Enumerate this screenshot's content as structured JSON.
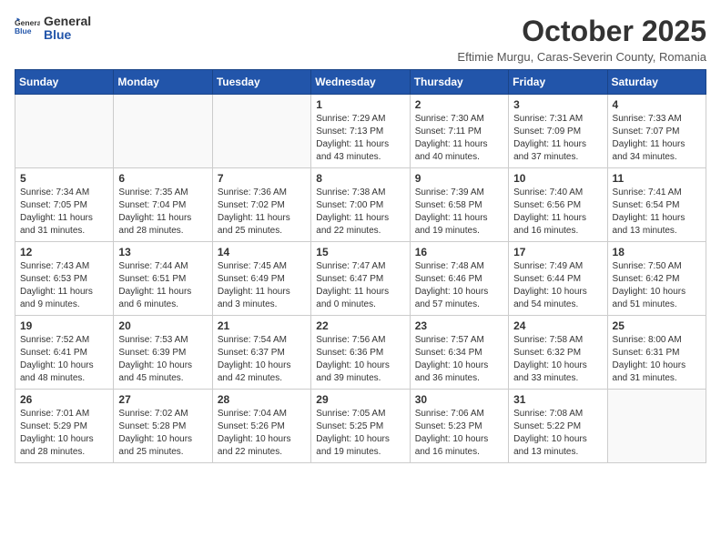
{
  "header": {
    "logo_general": "General",
    "logo_blue": "Blue",
    "title": "October 2025",
    "subtitle": "Eftimie Murgu, Caras-Severin County, Romania"
  },
  "columns": [
    "Sunday",
    "Monday",
    "Tuesday",
    "Wednesday",
    "Thursday",
    "Friday",
    "Saturday"
  ],
  "weeks": [
    {
      "alt": false,
      "days": [
        {
          "num": "",
          "info": ""
        },
        {
          "num": "",
          "info": ""
        },
        {
          "num": "",
          "info": ""
        },
        {
          "num": "1",
          "info": "Sunrise: 7:29 AM\nSunset: 7:13 PM\nDaylight: 11 hours\nand 43 minutes."
        },
        {
          "num": "2",
          "info": "Sunrise: 7:30 AM\nSunset: 7:11 PM\nDaylight: 11 hours\nand 40 minutes."
        },
        {
          "num": "3",
          "info": "Sunrise: 7:31 AM\nSunset: 7:09 PM\nDaylight: 11 hours\nand 37 minutes."
        },
        {
          "num": "4",
          "info": "Sunrise: 7:33 AM\nSunset: 7:07 PM\nDaylight: 11 hours\nand 34 minutes."
        }
      ]
    },
    {
      "alt": true,
      "days": [
        {
          "num": "5",
          "info": "Sunrise: 7:34 AM\nSunset: 7:05 PM\nDaylight: 11 hours\nand 31 minutes."
        },
        {
          "num": "6",
          "info": "Sunrise: 7:35 AM\nSunset: 7:04 PM\nDaylight: 11 hours\nand 28 minutes."
        },
        {
          "num": "7",
          "info": "Sunrise: 7:36 AM\nSunset: 7:02 PM\nDaylight: 11 hours\nand 25 minutes."
        },
        {
          "num": "8",
          "info": "Sunrise: 7:38 AM\nSunset: 7:00 PM\nDaylight: 11 hours\nand 22 minutes."
        },
        {
          "num": "9",
          "info": "Sunrise: 7:39 AM\nSunset: 6:58 PM\nDaylight: 11 hours\nand 19 minutes."
        },
        {
          "num": "10",
          "info": "Sunrise: 7:40 AM\nSunset: 6:56 PM\nDaylight: 11 hours\nand 16 minutes."
        },
        {
          "num": "11",
          "info": "Sunrise: 7:41 AM\nSunset: 6:54 PM\nDaylight: 11 hours\nand 13 minutes."
        }
      ]
    },
    {
      "alt": false,
      "days": [
        {
          "num": "12",
          "info": "Sunrise: 7:43 AM\nSunset: 6:53 PM\nDaylight: 11 hours\nand 9 minutes."
        },
        {
          "num": "13",
          "info": "Sunrise: 7:44 AM\nSunset: 6:51 PM\nDaylight: 11 hours\nand 6 minutes."
        },
        {
          "num": "14",
          "info": "Sunrise: 7:45 AM\nSunset: 6:49 PM\nDaylight: 11 hours\nand 3 minutes."
        },
        {
          "num": "15",
          "info": "Sunrise: 7:47 AM\nSunset: 6:47 PM\nDaylight: 11 hours\nand 0 minutes."
        },
        {
          "num": "16",
          "info": "Sunrise: 7:48 AM\nSunset: 6:46 PM\nDaylight: 10 hours\nand 57 minutes."
        },
        {
          "num": "17",
          "info": "Sunrise: 7:49 AM\nSunset: 6:44 PM\nDaylight: 10 hours\nand 54 minutes."
        },
        {
          "num": "18",
          "info": "Sunrise: 7:50 AM\nSunset: 6:42 PM\nDaylight: 10 hours\nand 51 minutes."
        }
      ]
    },
    {
      "alt": true,
      "days": [
        {
          "num": "19",
          "info": "Sunrise: 7:52 AM\nSunset: 6:41 PM\nDaylight: 10 hours\nand 48 minutes."
        },
        {
          "num": "20",
          "info": "Sunrise: 7:53 AM\nSunset: 6:39 PM\nDaylight: 10 hours\nand 45 minutes."
        },
        {
          "num": "21",
          "info": "Sunrise: 7:54 AM\nSunset: 6:37 PM\nDaylight: 10 hours\nand 42 minutes."
        },
        {
          "num": "22",
          "info": "Sunrise: 7:56 AM\nSunset: 6:36 PM\nDaylight: 10 hours\nand 39 minutes."
        },
        {
          "num": "23",
          "info": "Sunrise: 7:57 AM\nSunset: 6:34 PM\nDaylight: 10 hours\nand 36 minutes."
        },
        {
          "num": "24",
          "info": "Sunrise: 7:58 AM\nSunset: 6:32 PM\nDaylight: 10 hours\nand 33 minutes."
        },
        {
          "num": "25",
          "info": "Sunrise: 8:00 AM\nSunset: 6:31 PM\nDaylight: 10 hours\nand 31 minutes."
        }
      ]
    },
    {
      "alt": false,
      "days": [
        {
          "num": "26",
          "info": "Sunrise: 7:01 AM\nSunset: 5:29 PM\nDaylight: 10 hours\nand 28 minutes."
        },
        {
          "num": "27",
          "info": "Sunrise: 7:02 AM\nSunset: 5:28 PM\nDaylight: 10 hours\nand 25 minutes."
        },
        {
          "num": "28",
          "info": "Sunrise: 7:04 AM\nSunset: 5:26 PM\nDaylight: 10 hours\nand 22 minutes."
        },
        {
          "num": "29",
          "info": "Sunrise: 7:05 AM\nSunset: 5:25 PM\nDaylight: 10 hours\nand 19 minutes."
        },
        {
          "num": "30",
          "info": "Sunrise: 7:06 AM\nSunset: 5:23 PM\nDaylight: 10 hours\nand 16 minutes."
        },
        {
          "num": "31",
          "info": "Sunrise: 7:08 AM\nSunset: 5:22 PM\nDaylight: 10 hours\nand 13 minutes."
        },
        {
          "num": "",
          "info": ""
        }
      ]
    }
  ]
}
